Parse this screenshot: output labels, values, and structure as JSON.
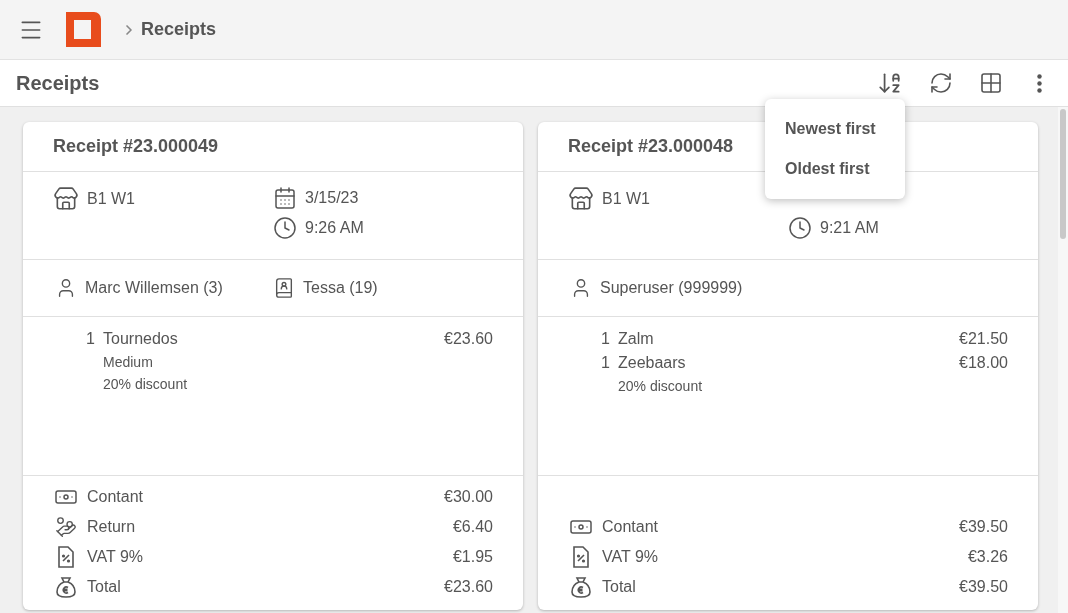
{
  "breadcrumb": {
    "current": "Receipts"
  },
  "toolbar": {
    "title": "Receipts"
  },
  "sort_menu": {
    "options": [
      "Newest first",
      "Oldest first"
    ]
  },
  "receipts": [
    {
      "title": "Receipt #23.000049",
      "location": "B1 W1",
      "date": "3/15/23",
      "time": "9:26 AM",
      "people": [
        {
          "kind": "user",
          "text": "Marc Willemsen (3)"
        },
        {
          "kind": "contact",
          "text": "Tessa (19)"
        }
      ],
      "items": [
        {
          "qty": "1",
          "name": "Tournedos",
          "price": "€23.60",
          "notes": [
            "Medium",
            "20% discount"
          ]
        }
      ],
      "totals": [
        {
          "kind": "cash",
          "label": "Contant",
          "amount": "€30.00"
        },
        {
          "kind": "return",
          "label": "Return",
          "amount": "€6.40"
        },
        {
          "kind": "vat",
          "label": "VAT 9%",
          "amount": "€1.95"
        },
        {
          "kind": "total",
          "label": "Total",
          "amount": "€23.60"
        }
      ]
    },
    {
      "title": "Receipt #23.000048",
      "location": "B1 W1",
      "time": "9:21 AM",
      "people": [
        {
          "kind": "user",
          "text": "Superuser (999999)"
        }
      ],
      "items": [
        {
          "qty": "1",
          "name": "Zalm",
          "price": "€21.50"
        },
        {
          "qty": "1",
          "name": "Zeebaars",
          "price": "€18.00",
          "notes": [
            "20% discount"
          ]
        }
      ],
      "totals": [
        {
          "kind": "cash",
          "label": "Contant",
          "amount": "€39.50"
        },
        {
          "kind": "vat",
          "label": "VAT 9%",
          "amount": "€3.26"
        },
        {
          "kind": "total",
          "label": "Total",
          "amount": "€39.50"
        }
      ]
    }
  ]
}
